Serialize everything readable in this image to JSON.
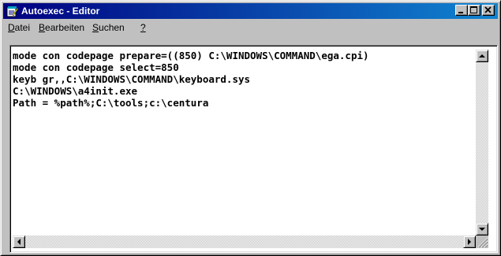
{
  "window": {
    "title": "Autoexec - Editor",
    "icon": "notepad-icon"
  },
  "controls": {
    "minimize_icon": "minimize-icon",
    "maximize_icon": "maximize-icon",
    "close_icon": "close-icon"
  },
  "menu": {
    "items": [
      {
        "accel": "D",
        "rest": "atei"
      },
      {
        "accel": "B",
        "rest": "earbeiten"
      },
      {
        "accel": "S",
        "rest": "uchen"
      },
      {
        "accel": "?",
        "rest": ""
      }
    ]
  },
  "editor": {
    "lines": [
      "mode con codepage prepare=((850) C:\\WINDOWS\\COMMAND\\ega.cpi)",
      "mode con codepage select=850",
      "keyb gr,,C:\\WINDOWS\\COMMAND\\keyboard.sys",
      "C:\\WINDOWS\\a4init.exe",
      "Path = %path%;C:\\tools;c:\\centura"
    ]
  },
  "colors": {
    "titlebar_start": "#000080",
    "titlebar_end": "#1084d0",
    "face": "#c0c0c0",
    "text_background": "#ffffff"
  }
}
